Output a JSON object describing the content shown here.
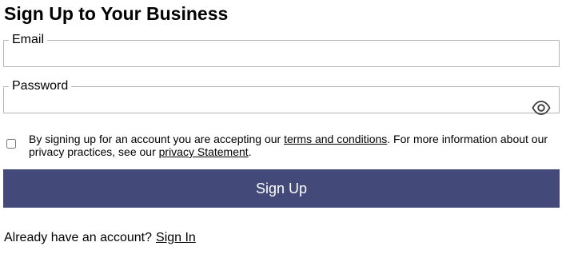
{
  "page": {
    "title": "Sign Up to Your Business"
  },
  "form": {
    "email": {
      "label": "Email",
      "value": "",
      "placeholder": ""
    },
    "password": {
      "label": "Password",
      "value": "",
      "placeholder": "",
      "toggle_icon": "eye-icon"
    },
    "consent": {
      "checked": false,
      "text_before": "By signing up for an account you are accepting our ",
      "terms_link": "terms and conditions",
      "text_middle": ". For more information about our privacy practices, see our ",
      "privacy_link": "privacy Statement",
      "text_after": "."
    },
    "submit_label": "Sign Up"
  },
  "footer": {
    "prompt": "Already have an account?",
    "signin_link": "Sign In"
  },
  "colors": {
    "button_background": "#434a7a",
    "button_text": "#ffffff",
    "field_border": "#b3b3b3"
  }
}
